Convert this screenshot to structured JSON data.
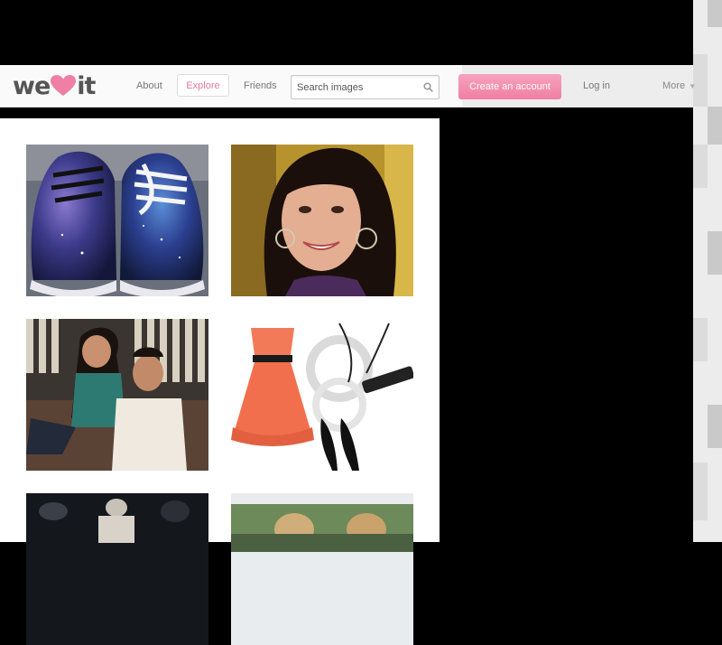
{
  "brand": {
    "logo_left": "we",
    "logo_right": "it",
    "accent": "#ef7fa4"
  },
  "nav": {
    "about": "About",
    "explore": "Explore",
    "friends": "Friends",
    "login": "Log in",
    "more": "More",
    "create_account": "Create an account"
  },
  "search": {
    "placeholder": "Search images",
    "icon": "magnifier-icon"
  },
  "images": [
    {
      "name": "galaxy-sneakers"
    },
    {
      "name": "smiling-girl-portrait"
    },
    {
      "name": "couple-on-couch"
    },
    {
      "name": "coral-dress-outfit"
    },
    {
      "name": "dark-crowd-photo"
    },
    {
      "name": "outdoor-girls-photo"
    }
  ]
}
